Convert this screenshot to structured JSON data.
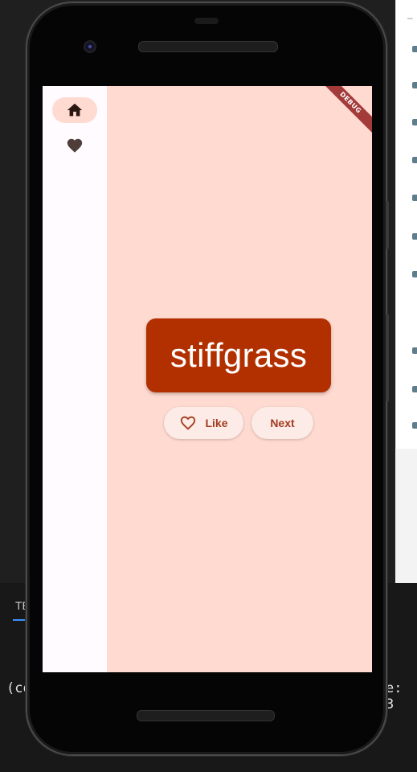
{
  "ide": {
    "panel_tab_label": "TE",
    "terminal_left_text": "(co",
    "terminal_right_text": "e: 3"
  },
  "app": {
    "nav": {
      "items": [
        {
          "icon": "home-icon",
          "selected": true
        },
        {
          "icon": "heart-icon",
          "selected": false
        }
      ]
    },
    "word_pair": "stiffgrass",
    "like_label": "Like",
    "next_label": "Next",
    "debug_banner": "DEBUG"
  },
  "colors": {
    "screen_background": "#ffdad0",
    "rail_background": "#fffbff",
    "word_card": "#b23000",
    "button_background": "#fcebe6",
    "button_text": "#a33b1f",
    "debug_banner": "#a33b3b"
  }
}
